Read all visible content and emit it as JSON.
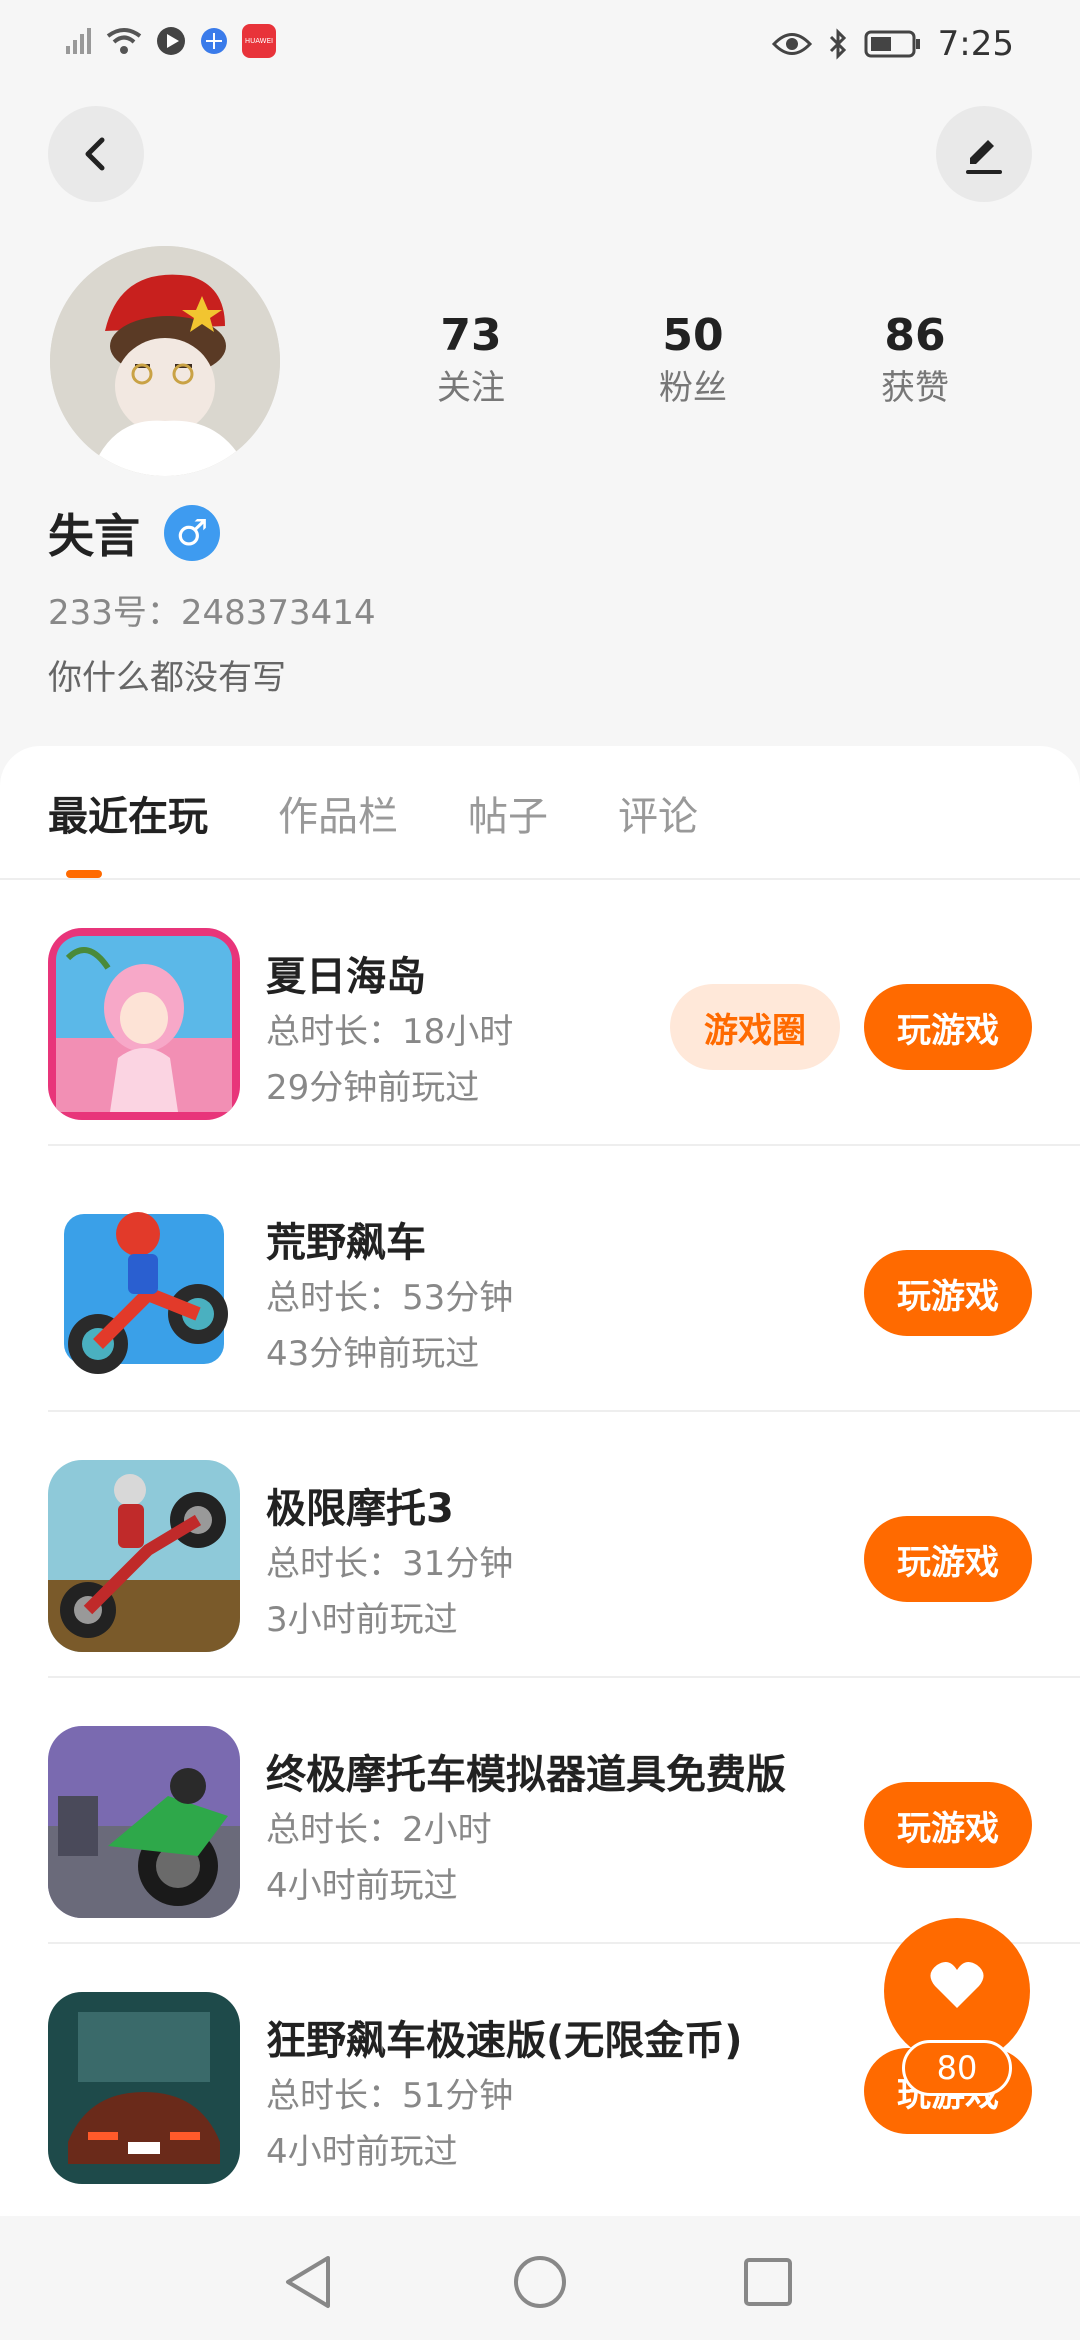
{
  "status_bar": {
    "time": "7:25",
    "app_badge": "HUAWEI"
  },
  "profile": {
    "nickname": "失言",
    "gender_symbol": "♂",
    "user_id": "233号：248373414",
    "bio": "你什么都没有写",
    "stats": [
      {
        "value": "73",
        "label": "关注"
      },
      {
        "value": "50",
        "label": "粉丝"
      },
      {
        "value": "86",
        "label": "获赞"
      }
    ]
  },
  "tabs": [
    {
      "label": "最近在玩",
      "active": true
    },
    {
      "label": "作品栏",
      "active": false
    },
    {
      "label": "帖子",
      "active": false
    },
    {
      "label": "评论",
      "active": false
    }
  ],
  "games": [
    {
      "title": "夏日海岛",
      "duration": "总时长：18小时",
      "last_played": "29分钟前玩过",
      "circle_label": "游戏圈",
      "play_label": "玩游戏"
    },
    {
      "title": "荒野飙车",
      "duration": "总时长：53分钟",
      "last_played": "43分钟前玩过",
      "play_label": "玩游戏"
    },
    {
      "title": "极限摩托3",
      "duration": "总时长：31分钟",
      "last_played": "3小时前玩过",
      "play_label": "玩游戏"
    },
    {
      "title": "终极摩托车模拟器道具免费版",
      "duration": "总时长：2小时",
      "last_played": "4小时前玩过",
      "play_label": "玩游戏"
    },
    {
      "title": "狂野飙车极速版(无限金币)",
      "duration": "总时长：51分钟",
      "last_played": "4小时前玩过",
      "play_label": "玩游戏"
    }
  ],
  "like_fab": {
    "count": "80"
  },
  "colors": {
    "accent": "#ff6a00",
    "accent_light": "#ffe8d9",
    "gender_blue": "#3e9bf0"
  }
}
